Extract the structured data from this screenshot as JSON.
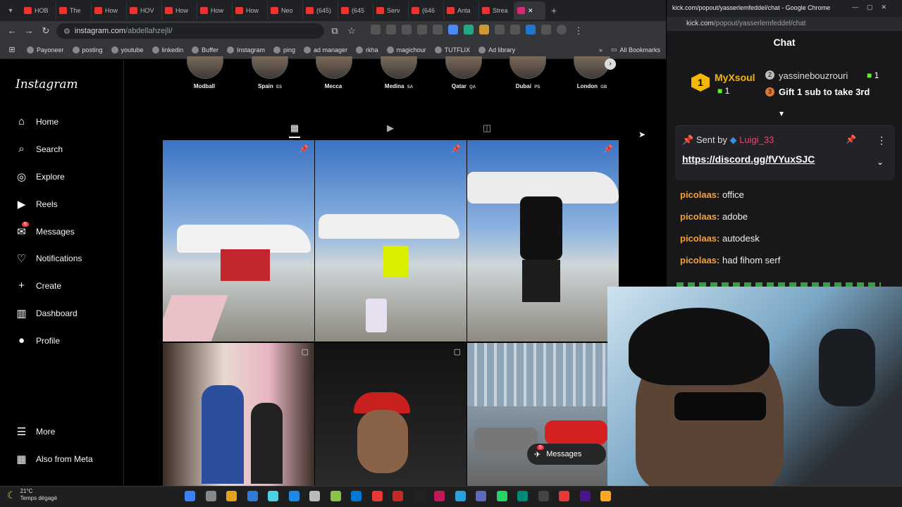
{
  "browser": {
    "tabs": [
      "HOB",
      "The",
      "How",
      "HOV",
      "How",
      "How",
      "How",
      "Neo",
      "(645)",
      "(645",
      "Serv",
      "(646",
      "Anta",
      "Strea"
    ],
    "url": "instagram.com/abdellahzejli/",
    "url_host": "instagram.com",
    "url_path": "/abdellahzejli/",
    "bookmarks": [
      "Payoneer",
      "posting",
      "youtube",
      "linkedin",
      "Buffer",
      "Instagram",
      "ping",
      "ad manager",
      "rkha",
      "magichour",
      "TUTFLIX",
      "Ad library"
    ],
    "all_bookmarks": "All Bookmarks"
  },
  "instagram": {
    "logo": "Instagram",
    "nav": [
      {
        "label": "Home",
        "icon": "home-icon"
      },
      {
        "label": "Search",
        "icon": "search-icon"
      },
      {
        "label": "Explore",
        "icon": "compass-icon"
      },
      {
        "label": "Reels",
        "icon": "reels-icon"
      },
      {
        "label": "Messages",
        "icon": "messenger-icon",
        "badge": "6"
      },
      {
        "label": "Notifications",
        "icon": "heart-icon"
      },
      {
        "label": "Create",
        "icon": "plus-icon"
      },
      {
        "label": "Dashboard",
        "icon": "chart-icon"
      },
      {
        "label": "Profile",
        "icon": "avatar-icon"
      }
    ],
    "more": "More",
    "also_from_meta": "Also from Meta",
    "highlights": [
      {
        "title": "Modball",
        "flag": ""
      },
      {
        "title": "Spain",
        "flag": "ES"
      },
      {
        "title": "Mecca",
        "flag": ""
      },
      {
        "title": "Medina",
        "flag": "SA"
      },
      {
        "title": "Qatar",
        "flag": "QA"
      },
      {
        "title": "Dubai",
        "flag": "PS"
      },
      {
        "title": "London",
        "flag": "GB"
      }
    ],
    "messages_bubble": "Messages",
    "messages_badge": "5"
  },
  "chat_window": {
    "title": "kick.com/popout/yasserlemfeddel/chat - Google Chrome",
    "url_host": "kick.com",
    "url_path": "/popout/yasserlemfeddel/chat",
    "header": "Chat",
    "leaderboard": {
      "first_user": "MyXsoul",
      "first_count": "1",
      "second_user": "yassinebouzrouri",
      "second_count": "1",
      "gift_label": "Gift 1 sub to take 3rd"
    },
    "pinned": {
      "sent_by": "Sent by",
      "user": "Luigi_33",
      "link": "https://discord.gg/fVYuxSJC"
    },
    "messages": [
      {
        "user": "picolaas:",
        "text": "office"
      },
      {
        "user": "picolaas:",
        "text": "adobe"
      },
      {
        "user": "picolaas:",
        "text": "autodesk"
      },
      {
        "user": "picolaas:",
        "text": "had fihom serf"
      }
    ]
  },
  "taskbar": {
    "temp": "21°C",
    "weather": "Temps dégagé"
  }
}
